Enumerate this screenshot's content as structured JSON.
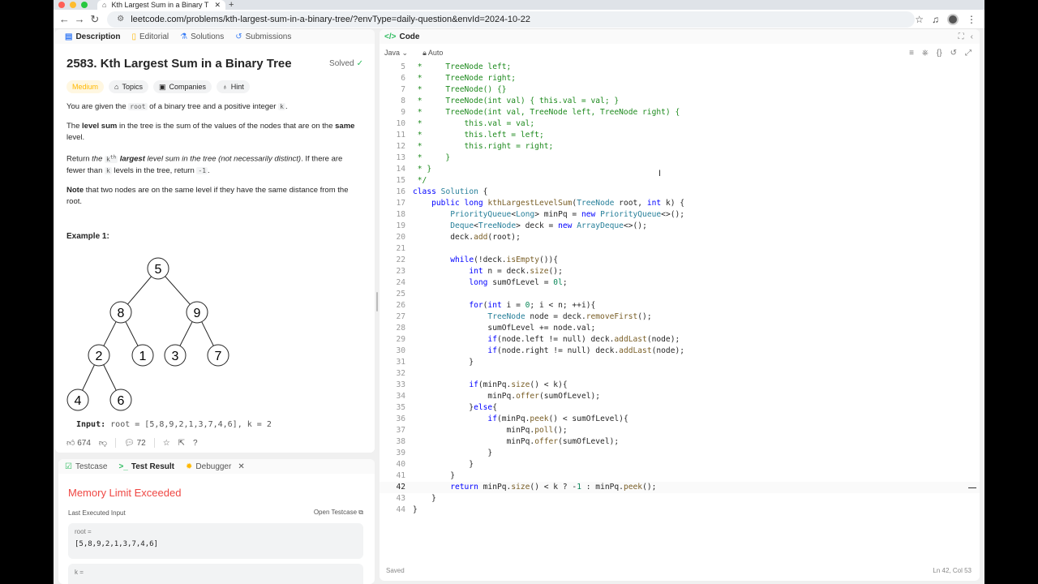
{
  "browser": {
    "tab_title": "Kth Largest Sum in a Binary T",
    "url": "leetcode.com/problems/kth-largest-sum-in-a-binary-tree/?envType=daily-question&envId=2024-10-22"
  },
  "left_tabs": [
    "Description",
    "Editorial",
    "Solutions",
    "Submissions"
  ],
  "problem": {
    "title": "2583. Kth Largest Sum in a Binary Tree",
    "status": "Solved",
    "difficulty": "Medium",
    "tags": [
      "Topics",
      "Companies",
      "Hint"
    ],
    "p1_a": "You are given the ",
    "p1_code1": "root",
    "p1_b": " of a binary tree and a positive integer ",
    "p1_code2": "k",
    "p1_c": ".",
    "p2_a": "The ",
    "p2_b": "level sum",
    "p2_c": " in the tree is the sum of the values of the nodes that are on the ",
    "p2_d": "same",
    "p2_e": " level.",
    "p3_a": "Return ",
    "p3_b": "the ",
    "p3_code1": "k",
    "p3_sup": "th",
    "p3_c": "largest",
    "p3_d": " level sum in the tree (not necessarily distinct)",
    "p3_e": ". If there are fewer than ",
    "p3_code2": "k",
    "p3_f": " levels in the tree, return ",
    "p3_code3": "-1",
    "p3_g": ".",
    "p4_a": "Note",
    "p4_b": " that two nodes are on the same level if they have the same distance from the root.",
    "example_title": "Example 1:",
    "input_label": "Input:",
    "input_value": "root = [5,8,9,2,1,3,7,4,6], k = 2",
    "likes": "674",
    "comments": "72"
  },
  "tree_nodes": [
    "5",
    "8",
    "9",
    "2",
    "1",
    "3",
    "7",
    "4",
    "6"
  ],
  "results": {
    "tabs": [
      "Testcase",
      "Test Result",
      "Debugger"
    ],
    "status": "Memory Limit Exceeded",
    "last_input_label": "Last Executed Input",
    "open_testcase": "Open Testcase",
    "root_label": "root =",
    "root_value": "[5,8,9,2,1,3,7,4,6]",
    "k_label": "k ="
  },
  "code": {
    "header": "Code",
    "language": "Java",
    "mode": "Auto",
    "saved": "Saved",
    "cursor_pos": "Ln 42, Col 53",
    "lines": [
      {
        "n": "5",
        "t": " *     TreeNode left;"
      },
      {
        "n": "6",
        "t": " *     TreeNode right;"
      },
      {
        "n": "7",
        "t": " *     TreeNode() {}"
      },
      {
        "n": "8",
        "t": " *     TreeNode(int val) { this.val = val; }"
      },
      {
        "n": "9",
        "t": " *     TreeNode(int val, TreeNode left, TreeNode right) {"
      },
      {
        "n": "10",
        "t": " *         this.val = val;"
      },
      {
        "n": "11",
        "t": " *         this.left = left;"
      },
      {
        "n": "12",
        "t": " *         this.right = right;"
      },
      {
        "n": "13",
        "t": " *     }"
      },
      {
        "n": "14",
        "t": " * }"
      },
      {
        "n": "15",
        "t": " */"
      },
      {
        "n": "16",
        "t": "class Solution {"
      },
      {
        "n": "17",
        "t": "    public long kthLargestLevelSum(TreeNode root, int k) {"
      },
      {
        "n": "18",
        "t": "        PriorityQueue<Long> minPq = new PriorityQueue<>();"
      },
      {
        "n": "19",
        "t": "        Deque<TreeNode> deck = new ArrayDeque<>();"
      },
      {
        "n": "20",
        "t": "        deck.add(root);"
      },
      {
        "n": "21",
        "t": ""
      },
      {
        "n": "22",
        "t": "        while(!deck.isEmpty()){"
      },
      {
        "n": "23",
        "t": "            int n = deck.size();"
      },
      {
        "n": "24",
        "t": "            long sumOfLevel = 0l;"
      },
      {
        "n": "25",
        "t": ""
      },
      {
        "n": "26",
        "t": "            for(int i = 0; i < n; ++i){"
      },
      {
        "n": "27",
        "t": "                TreeNode node = deck.removeFirst();"
      },
      {
        "n": "28",
        "t": "                sumOfLevel += node.val;"
      },
      {
        "n": "29",
        "t": "                if(node.left != null) deck.addLast(node);"
      },
      {
        "n": "30",
        "t": "                if(node.right != null) deck.addLast(node);"
      },
      {
        "n": "31",
        "t": "            }"
      },
      {
        "n": "32",
        "t": ""
      },
      {
        "n": "33",
        "t": "            if(minPq.size() < k){"
      },
      {
        "n": "34",
        "t": "                minPq.offer(sumOfLevel);"
      },
      {
        "n": "35",
        "t": "            }else{"
      },
      {
        "n": "36",
        "t": "                if(minPq.peek() < sumOfLevel){"
      },
      {
        "n": "37",
        "t": "                    minPq.poll();"
      },
      {
        "n": "38",
        "t": "                    minPq.offer(sumOfLevel);"
      },
      {
        "n": "39",
        "t": "                }"
      },
      {
        "n": "40",
        "t": "            }"
      },
      {
        "n": "41",
        "t": "        }"
      },
      {
        "n": "42",
        "t": "        return minPq.size() < k ? -1 : minPq.peek();"
      },
      {
        "n": "43",
        "t": "    }"
      },
      {
        "n": "44",
        "t": "}"
      }
    ]
  }
}
